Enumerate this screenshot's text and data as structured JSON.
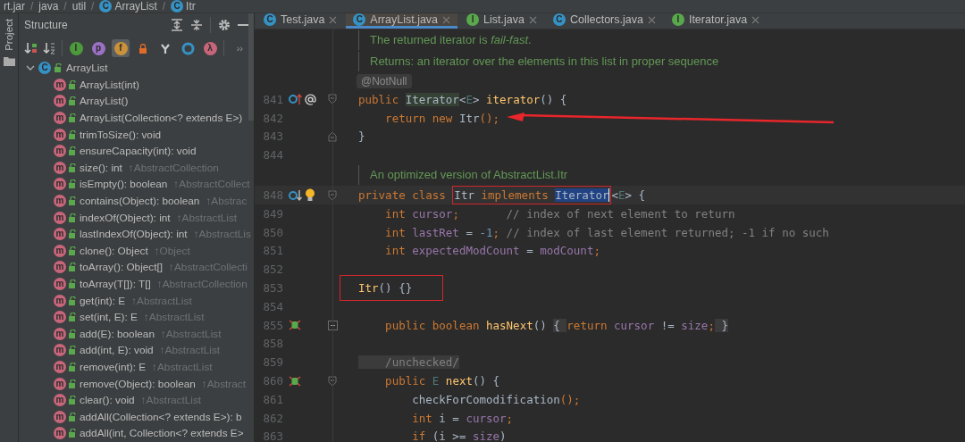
{
  "breadcrumb": [
    {
      "label": "rt.jar"
    },
    {
      "separator": "/",
      "label": "java"
    },
    {
      "separator": "/",
      "label": "util"
    },
    {
      "separator": "/",
      "label": "ArrayList",
      "badge": "C"
    },
    {
      "separator": "/",
      "label": "Itr",
      "badge": "C"
    }
  ],
  "side_strip": {
    "label": "Project"
  },
  "structure": {
    "title": "Structure",
    "filters": [
      {
        "kind": "sort-visibility"
      },
      {
        "kind": "sort-alpha"
      },
      {
        "kind": "badge",
        "glyph": "I",
        "color": "#4c9a3c",
        "selected": false
      },
      {
        "kind": "badge",
        "glyph": "p",
        "color": "#9a71c4",
        "selected": false
      },
      {
        "kind": "badge",
        "glyph": "f",
        "color": "#c9923a",
        "selected": true
      },
      {
        "kind": "lock",
        "selected": false
      },
      {
        "kind": "fork",
        "selected": false
      },
      {
        "kind": "ring",
        "selected": false
      },
      {
        "kind": "badge",
        "glyph": "λ",
        "color": "#c7657a",
        "selected": false
      }
    ],
    "more": "››",
    "tree": {
      "label": "ArrayList",
      "badge": "C",
      "expanded": true,
      "children": [
        {
          "label": "ArrayList(int)",
          "badge": "m"
        },
        {
          "label": "ArrayList()",
          "badge": "m"
        },
        {
          "label": "ArrayList(Collection<? extends E>)",
          "badge": "m"
        },
        {
          "label": "trimToSize(): void",
          "badge": "m"
        },
        {
          "label": "ensureCapacity(int): void",
          "badge": "m"
        },
        {
          "label": "size(): int",
          "inherited": "↑AbstractCollection",
          "badge": "m"
        },
        {
          "label": "isEmpty(): boolean",
          "inherited": "↑AbstractCollect",
          "badge": "m"
        },
        {
          "label": "contains(Object): boolean",
          "inherited": "↑Abstrac",
          "badge": "m"
        },
        {
          "label": "indexOf(Object): int",
          "inherited": "↑AbstractList",
          "badge": "m"
        },
        {
          "label": "lastIndexOf(Object): int",
          "inherited": "↑AbstractLis",
          "badge": "m"
        },
        {
          "label": "clone(): Object",
          "inherited": "↑Object",
          "badge": "m"
        },
        {
          "label": "toArray(): Object[]",
          "inherited": "↑AbstractCollecti",
          "badge": "m"
        },
        {
          "label": "toArray(T[]): T[]",
          "inherited": "↑AbstractCollection",
          "badge": "m"
        },
        {
          "label": "get(int): E",
          "inherited": "↑AbstractList",
          "badge": "m"
        },
        {
          "label": "set(int, E): E",
          "inherited": "↑AbstractList",
          "badge": "m"
        },
        {
          "label": "add(E): boolean",
          "inherited": "↑AbstractList",
          "badge": "m"
        },
        {
          "label": "add(int, E): void",
          "inherited": "↑AbstractList",
          "badge": "m"
        },
        {
          "label": "remove(int): E",
          "inherited": "↑AbstractList",
          "badge": "m"
        },
        {
          "label": "remove(Object): boolean",
          "inherited": "↑Abstract",
          "badge": "m"
        },
        {
          "label": "clear(): void",
          "inherited": "↑AbstractList",
          "badge": "m"
        },
        {
          "label": "addAll(Collection<? extends E>): b",
          "badge": "m"
        },
        {
          "label": "addAll(int, Collection<? extends E>",
          "badge": "m"
        }
      ]
    }
  },
  "tabs": [
    {
      "label": "Test.java",
      "badge": "C",
      "kind": "class",
      "selected": false
    },
    {
      "label": "ArrayList.java",
      "badge": "C",
      "kind": "class",
      "selected": true
    },
    {
      "label": "List.java",
      "badge": "I",
      "kind": "interface",
      "selected": false
    },
    {
      "label": "Collectors.java",
      "badge": "C",
      "kind": "class",
      "selected": false
    },
    {
      "label": "Iterator.java",
      "badge": "I",
      "kind": "interface",
      "selected": false
    }
  ],
  "editor": {
    "lines": [
      {
        "kind": "doc",
        "text": "The returned iterator is *fail-fast*."
      },
      {
        "kind": "doc",
        "text": "Returns: an iterator over the elements in this list in proper sequence"
      },
      {
        "kind": "inlay",
        "text": "@NotNull"
      },
      {
        "kind": "code",
        "number": "841",
        "gutter": [
          {
            "kind": "overrides"
          },
          {
            "kind": "annotation"
          }
        ],
        "fold": {
          "kind": "start"
        },
        "segments": [
          {
            "text": "public ",
            "kind": "kw"
          },
          {
            "text": "Iterator",
            "kind": "plain",
            "usage": true
          },
          {
            "text": "<",
            "kind": "plain"
          },
          {
            "text": "E",
            "kind": "tparam"
          },
          {
            "text": "> ",
            "kind": "plain"
          },
          {
            "text": "iterator",
            "kind": "fn"
          },
          {
            "text": "() {",
            "kind": "plain"
          }
        ]
      },
      {
        "kind": "code",
        "number": "842",
        "arrow": true,
        "segments": [
          {
            "text": "    return new ",
            "kind": "kw"
          },
          {
            "text": "Itr",
            "kind": "plain"
          },
          {
            "text": "();",
            "kind": "kw"
          }
        ]
      },
      {
        "kind": "code",
        "number": "843",
        "fold": {
          "kind": "end"
        },
        "segments": [
          {
            "text": "}",
            "kind": "plain"
          }
        ]
      },
      {
        "kind": "code",
        "number": "844"
      },
      {
        "kind": "doc",
        "text": "An optimized version of AbstractList.Itr"
      },
      {
        "kind": "code",
        "number": "848",
        "current": true,
        "gutter": [
          {
            "kind": "implemented"
          },
          {
            "kind": "bulb"
          }
        ],
        "fold": {
          "kind": "start"
        },
        "segments": [
          {
            "text": "private class ",
            "kind": "kw"
          },
          {
            "kind": "box",
            "tokens": [
              {
                "text": "Itr ",
                "kind": "plain"
              },
              {
                "text": "implements ",
                "kind": "kw"
              },
              {
                "text": "Iterator",
                "kind": "plain",
                "selected": true,
                "caret": true
              }
            ]
          },
          {
            "text": "<",
            "kind": "plain"
          },
          {
            "text": "E",
            "kind": "tparam"
          },
          {
            "text": "> {",
            "kind": "plain"
          }
        ]
      },
      {
        "kind": "code",
        "number": "849",
        "segments": [
          {
            "text": "    int ",
            "kind": "kw"
          },
          {
            "text": "cursor",
            "kind": "field"
          },
          {
            "text": ";       ",
            "kind": "kw"
          },
          {
            "text": "// index of next element to return",
            "kind": "comment"
          }
        ]
      },
      {
        "kind": "code",
        "number": "850",
        "segments": [
          {
            "text": "    int ",
            "kind": "kw"
          },
          {
            "text": "lastRet",
            "kind": "field"
          },
          {
            "text": " = ",
            "kind": "plain"
          },
          {
            "text": "-1",
            "kind": "num"
          },
          {
            "text": "; ",
            "kind": "kw"
          },
          {
            "text": "// index of last element returned; -1 if no such",
            "kind": "comment"
          }
        ]
      },
      {
        "kind": "code",
        "number": "851",
        "segments": [
          {
            "text": "    int ",
            "kind": "kw"
          },
          {
            "text": "expectedModCount",
            "kind": "field"
          },
          {
            "text": " = ",
            "kind": "plain"
          },
          {
            "text": "modCount",
            "kind": "field"
          },
          {
            "text": ";",
            "kind": "kw"
          }
        ]
      },
      {
        "kind": "code",
        "number": "852"
      },
      {
        "kind": "code",
        "number": "853",
        "segments": [
          {
            "kind": "box",
            "wide": true,
            "tokens": [
              {
                "text": "Itr",
                "kind": "fn"
              },
              {
                "text": "() {}",
                "kind": "plain"
              }
            ]
          }
        ]
      },
      {
        "kind": "code",
        "number": "854"
      },
      {
        "kind": "code",
        "number": "855",
        "gutter": [
          {
            "kind": "debug"
          }
        ],
        "fold": {
          "kind": "collapsed"
        },
        "segments": [
          {
            "text": "    public boolean ",
            "kind": "kw"
          },
          {
            "text": "hasNext",
            "kind": "fn"
          },
          {
            "text": "() ",
            "kind": "plain"
          },
          {
            "text": "{ ",
            "kind": "plain",
            "folded": true
          },
          {
            "text": "return ",
            "kind": "kw"
          },
          {
            "text": "cursor",
            "kind": "field"
          },
          {
            "text": " != ",
            "kind": "plain"
          },
          {
            "text": "size",
            "kind": "field"
          },
          {
            "text": ";",
            "kind": "kw"
          },
          {
            "text": " }",
            "kind": "plain",
            "folded": true
          }
        ]
      },
      {
        "kind": "code",
        "number": "858"
      },
      {
        "kind": "code",
        "number": "859",
        "segments": [
          {
            "text": "    /unchecked/",
            "kind": "comment",
            "folded": true
          }
        ]
      },
      {
        "kind": "code",
        "number": "860",
        "gutter": [
          {
            "kind": "debug"
          }
        ],
        "fold": {
          "kind": "start"
        },
        "segments": [
          {
            "text": "    public ",
            "kind": "kw"
          },
          {
            "text": "E ",
            "kind": "tparam"
          },
          {
            "text": "next",
            "kind": "fn"
          },
          {
            "text": "() {",
            "kind": "plain"
          }
        ]
      },
      {
        "kind": "code",
        "number": "861",
        "segments": [
          {
            "text": "        checkForComodification",
            "kind": "plain"
          },
          {
            "text": "();",
            "kind": "kw"
          }
        ]
      },
      {
        "kind": "code",
        "number": "862",
        "segments": [
          {
            "text": "        int ",
            "kind": "kw"
          },
          {
            "text": "i = ",
            "kind": "plain"
          },
          {
            "text": "cursor",
            "kind": "field"
          },
          {
            "text": ";",
            "kind": "kw"
          }
        ]
      },
      {
        "kind": "code",
        "number": "863",
        "segments": [
          {
            "text": "        if ",
            "kind": "kw"
          },
          {
            "text": "(i >= ",
            "kind": "plain"
          },
          {
            "text": "size",
            "kind": "field"
          },
          {
            "text": ")",
            "kind": "plain"
          }
        ]
      }
    ]
  }
}
